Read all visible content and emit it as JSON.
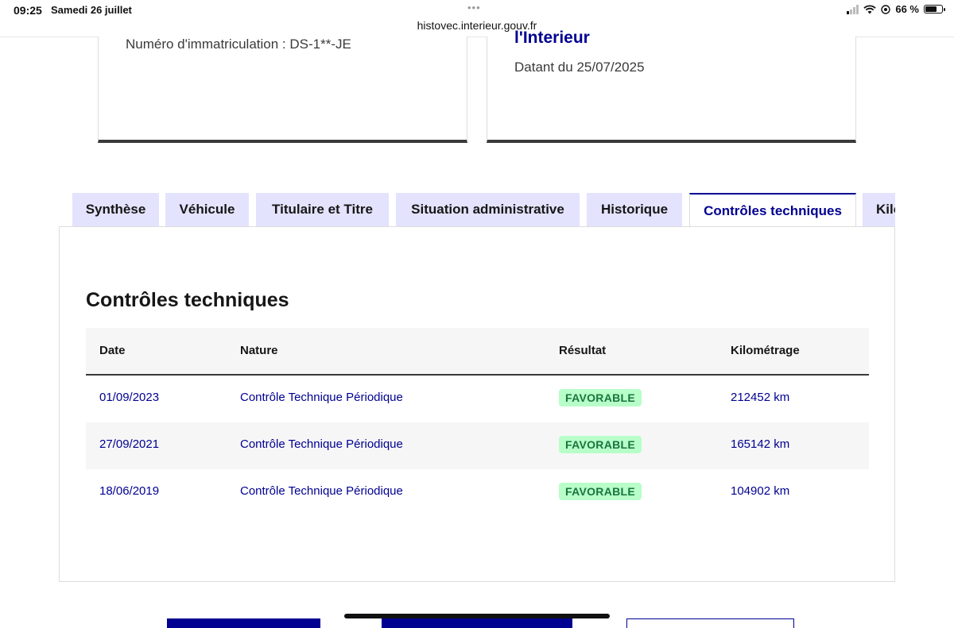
{
  "status_bar": {
    "time": "09:25",
    "date": "Samedi 26 juillet",
    "url": "histovec.interieur.gouv.fr",
    "battery": "66 %"
  },
  "cards": {
    "left": {
      "plate": "Numéro d'immatriculation : DS-1**-JE"
    },
    "right": {
      "heading_cut": "l'Interieur",
      "date": "Datant du 25/07/2025"
    }
  },
  "tabs": [
    {
      "label": "Synthèse"
    },
    {
      "label": "Véhicule"
    },
    {
      "label": "Titulaire et Titre"
    },
    {
      "label": "Situation administrative"
    },
    {
      "label": "Historique"
    },
    {
      "label": "Contrôles techniques"
    },
    {
      "label": "Kilométrage"
    }
  ],
  "panel": {
    "title": "Contrôles techniques",
    "columns": [
      "Date",
      "Nature",
      "Résultat",
      "Kilométrage"
    ],
    "rows": [
      {
        "date": "01/09/2023",
        "nature": "Contrôle Technique Périodique",
        "result": "FAVORABLE",
        "km": "212452 km"
      },
      {
        "date": "27/09/2021",
        "nature": "Contrôle Technique Périodique",
        "result": "FAVORABLE",
        "km": "165142 km"
      },
      {
        "date": "18/06/2019",
        "nature": "Contrôle Technique Périodique",
        "result": "FAVORABLE",
        "km": "104902 km"
      }
    ]
  },
  "colors": {
    "accent": "#000091",
    "tab_bg": "#e3e3fd",
    "success_bg": "#b8fec9",
    "success_text": "#18753c"
  }
}
